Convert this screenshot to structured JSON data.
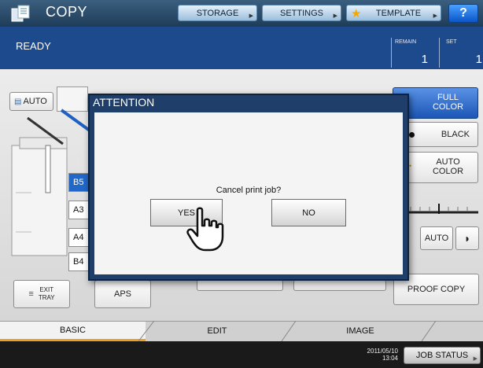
{
  "header": {
    "title": "COPY",
    "storage": "STORAGE",
    "settings": "SETTINGS",
    "template": "TEMPLATE",
    "help": "?"
  },
  "status": {
    "state": "READY",
    "remain_label": "REMAIN",
    "remain_value": "1",
    "set_label": "SET",
    "set_value": "1"
  },
  "main": {
    "auto_label": "AUTO",
    "papers": [
      "B5",
      "A3",
      "A4",
      "B4"
    ],
    "exit_tray": [
      "EXIT",
      "TRAY"
    ],
    "aps": "APS",
    "color_modes": [
      "FULL COLOR",
      "BLACK",
      "AUTO COLOR"
    ],
    "density_auto": "AUTO",
    "proof_copy": "PROOF COPY"
  },
  "tabs": [
    "BASIC",
    "EDIT",
    "IMAGE"
  ],
  "footer": {
    "date": "2011/05/10",
    "time": "13:04",
    "job_status": "JOB STATUS"
  },
  "dialog": {
    "title": "ATTENTION",
    "message": "Cancel print job?",
    "yes": "YES",
    "no": "NO"
  },
  "colors": {
    "header_bg": "#2b4c6c",
    "status_bg": "#1d4a8c",
    "accent": "#f0a020",
    "dialog_frame": "#1f3f6a"
  },
  "icons": [
    "copy-icon",
    "template-star-icon",
    "pointer-hand-icon",
    "original-document-icon",
    "exit-tray-icon"
  ]
}
